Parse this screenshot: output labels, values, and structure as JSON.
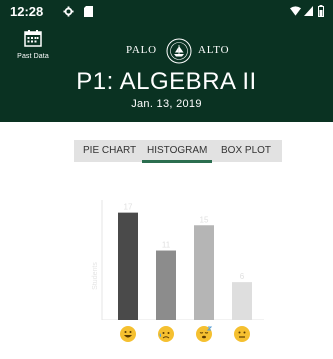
{
  "status": {
    "time": "12:28"
  },
  "header": {
    "past_data_label": "Past Data",
    "brand_left": "PALO",
    "brand_right": "ALTO",
    "title": "P1: ALGEBRA II",
    "date": "Jan. 13, 2019"
  },
  "tabs": [
    {
      "label": "PIE CHART",
      "selected": false
    },
    {
      "label": "HISTOGRAM",
      "selected": true
    },
    {
      "label": "BOX PLOT",
      "selected": false
    }
  ],
  "colors": {
    "header_bg": "#0a3222",
    "tab_bg": "#e2e2e2",
    "tab_underline": "#2b6e4f"
  },
  "chart_data": {
    "type": "bar",
    "categories": [
      "grinning",
      "sad-sweat",
      "sleepy",
      "neutral"
    ],
    "values": [
      17,
      11,
      15,
      6
    ],
    "data_labels": [
      "17",
      "11",
      "15",
      "6"
    ],
    "colors": [
      "#4a4a4a",
      "#8c8c8c",
      "#b5b5b5",
      "#dedede"
    ],
    "ylabel": "Students",
    "ylim": [
      0,
      19
    ],
    "grid": false
  }
}
